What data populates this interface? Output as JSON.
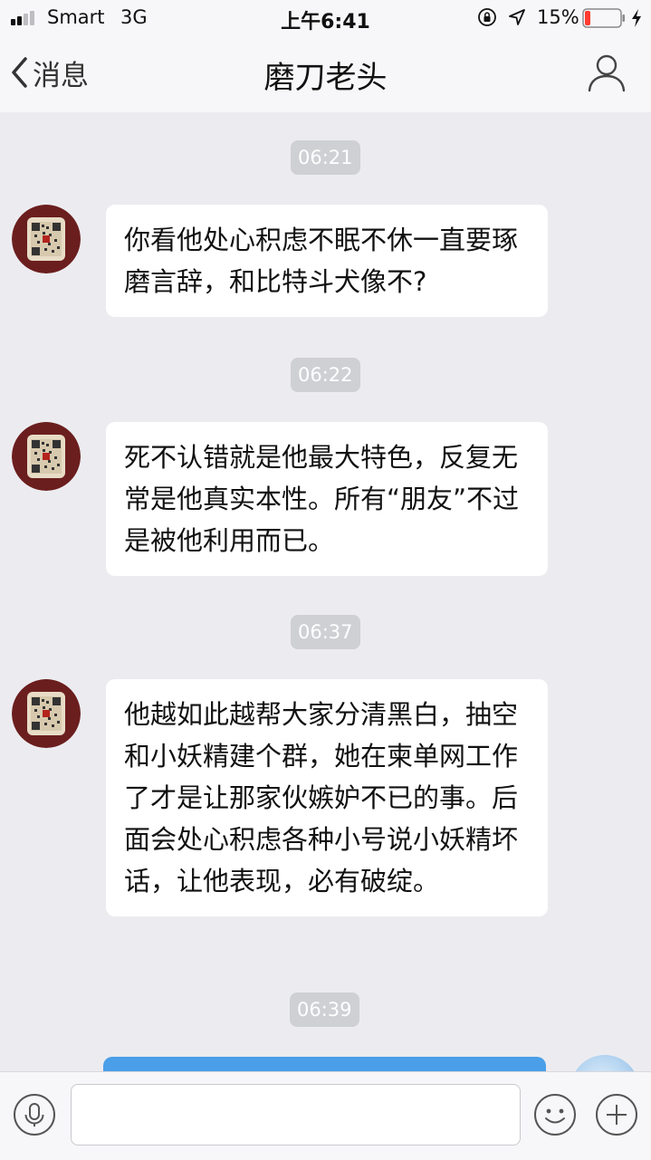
{
  "status_bar": {
    "carrier": "Smart",
    "network": "3G",
    "time": "上午6:41",
    "battery_percent": "15%",
    "battery_level": 0.15,
    "battery_color": "#ff3b30",
    "icons": [
      "signal-icon",
      "orientation-lock-icon",
      "location-icon",
      "battery-icon",
      "charging-icon"
    ]
  },
  "nav": {
    "back_label": "消息",
    "title": "磨刀老头",
    "profile_icon": "person-icon"
  },
  "messages": [
    {
      "time": "06:21",
      "direction": "received",
      "text": "你看他处心积虑不眠不休一直要琢磨言辞，和比特斗犬像不?"
    },
    {
      "time": "06:22",
      "direction": "received",
      "text": "死不认错就是他最大特色，反复无常是他真实本性。所有“朋友”不过是被他利用而已。"
    },
    {
      "time": "06:37",
      "direction": "received",
      "text": "他越如此越帮大家分清黑白，抽空和小妖精建个群，她在柬单网工作了才是让那家伙嫉妒不已的事。后面会处心积虑各种小号说小妖精坏话，让他表现，必有破绽。"
    },
    {
      "time": "06:39",
      "direction": "sent",
      "text": ""
    }
  ],
  "input_bar": {
    "voice_icon": "microphone-icon",
    "emoji_icon": "smiley-icon",
    "more_icon": "plus-icon",
    "input_value": "",
    "input_placeholder": ""
  },
  "colors": {
    "chat_background": "#ececf0",
    "received_bubble": "#ffffff",
    "sent_bubble": "#4a9fe8",
    "time_pill": "#cfd0d4"
  }
}
